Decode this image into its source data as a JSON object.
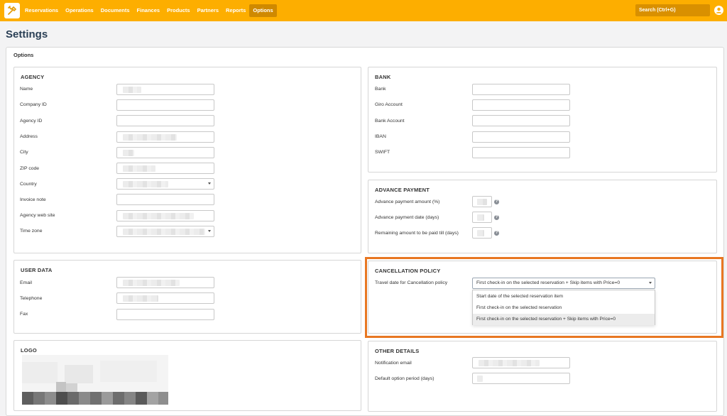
{
  "nav": {
    "items": [
      {
        "label": "Reservations",
        "active": false
      },
      {
        "label": "Operations",
        "active": false
      },
      {
        "label": "Documents",
        "active": false
      },
      {
        "label": "Finances",
        "active": false
      },
      {
        "label": "Products",
        "active": false
      },
      {
        "label": "Partners",
        "active": false
      },
      {
        "label": "Reports",
        "active": false
      },
      {
        "label": "Options",
        "active": true
      }
    ],
    "search_label": "Search (Ctrl+G)",
    "logo_icon": "tools-icon",
    "user_icon": "user-icon",
    "accent_color": "#fdae00"
  },
  "page": {
    "title": "Settings",
    "section_title": "Options"
  },
  "agency": {
    "title": "AGENCY",
    "fields": [
      {
        "label": "Name",
        "value": ""
      },
      {
        "label": "Company ID",
        "value": ""
      },
      {
        "label": "Agency ID",
        "value": ""
      },
      {
        "label": "Address",
        "value": ""
      },
      {
        "label": "City",
        "value": ""
      },
      {
        "label": "ZIP code",
        "value": ""
      },
      {
        "label": "Country",
        "value": ""
      },
      {
        "label": "Invoice note",
        "value": ""
      },
      {
        "label": "Agency web site",
        "value": ""
      },
      {
        "label": "Time zone",
        "value": ""
      }
    ]
  },
  "bank": {
    "title": "BANK",
    "fields": [
      {
        "label": "Bank",
        "value": ""
      },
      {
        "label": "Giro Account",
        "value": ""
      },
      {
        "label": "Bank Account",
        "value": ""
      },
      {
        "label": "IBAN",
        "value": ""
      },
      {
        "label": "SWIFT",
        "value": ""
      }
    ]
  },
  "advance_payment": {
    "title": "ADVANCE PAYMENT",
    "fields": [
      {
        "label": "Advance payment amount (%)",
        "value": ""
      },
      {
        "label": "Advance payment date (days)",
        "value": ""
      },
      {
        "label": "Remaining amount to be paid till (days)",
        "value": ""
      }
    ],
    "help_glyph": "?"
  },
  "user_data": {
    "title": "USER DATA",
    "fields": [
      {
        "label": "Email",
        "value": ""
      },
      {
        "label": "Telephone",
        "value": ""
      },
      {
        "label": "Fax",
        "value": ""
      }
    ]
  },
  "cancellation_policy": {
    "title": "CANCELLATION POLICY",
    "label": "Travel date for Cancellation policy",
    "selected": "First check-in on the selected reservation + Skip items with Price=0",
    "options": [
      "Start date of the selected reservation item",
      "First check-in on the selected reservation",
      "First check-in on the selected reservation + Skip items with Price=0"
    ],
    "highlight_color": "#e87722"
  },
  "other_details": {
    "title": "OTHER DETAILS",
    "fields": [
      {
        "label": "Notification email",
        "value": ""
      },
      {
        "label": "Default option period (days)",
        "value": ""
      }
    ]
  },
  "logo_panel": {
    "title": "LOGO"
  }
}
